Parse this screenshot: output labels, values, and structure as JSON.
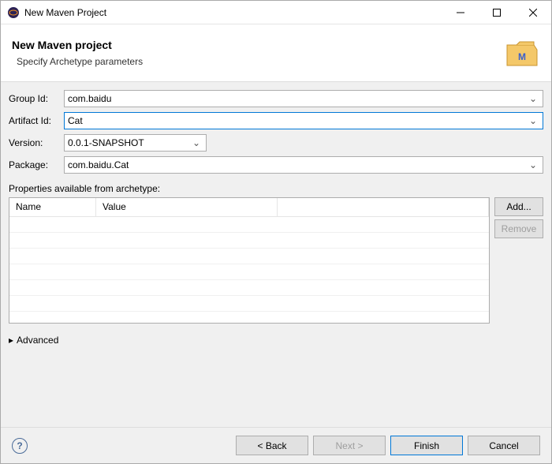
{
  "titlebar": {
    "text": "New Maven Project"
  },
  "header": {
    "title": "New Maven project",
    "subtitle": "Specify Archetype parameters"
  },
  "form": {
    "groupId": {
      "label": "Group Id:",
      "value": "com.baidu"
    },
    "artifactId": {
      "label": "Artifact Id:",
      "value": "Cat"
    },
    "version": {
      "label": "Version:",
      "value": "0.0.1-SNAPSHOT"
    },
    "package": {
      "label": "Package:",
      "value": "com.baidu.Cat"
    }
  },
  "properties": {
    "label": "Properties available from archetype:",
    "columns": {
      "name": "Name",
      "value": "Value"
    },
    "rows": [],
    "buttons": {
      "add": "Add...",
      "remove": "Remove"
    }
  },
  "advanced": {
    "label": "Advanced"
  },
  "footer": {
    "back": "< Back",
    "next": "Next >",
    "finish": "Finish",
    "cancel": "Cancel"
  }
}
